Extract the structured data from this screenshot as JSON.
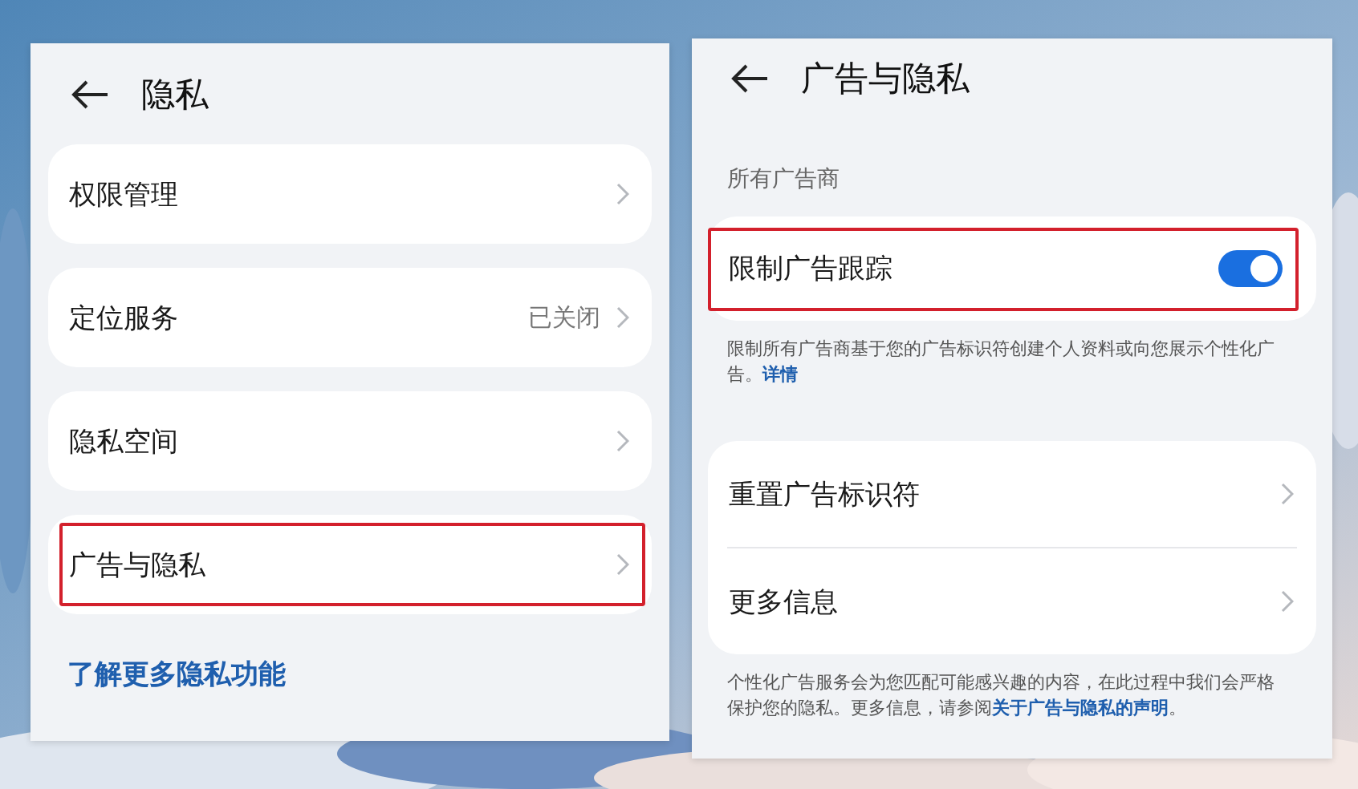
{
  "left_screen": {
    "title": "隐私",
    "items": [
      {
        "label": "权限管理",
        "highlighted": false
      },
      {
        "label": "定位服务",
        "value": "已关闭",
        "highlighted": false
      },
      {
        "label": "隐私空间",
        "highlighted": false
      },
      {
        "label": "广告与隐私",
        "highlighted": true
      }
    ],
    "link": "了解更多隐私功能"
  },
  "right_screen": {
    "title": "广告与隐私",
    "section_label": "所有广告商",
    "toggle_item": {
      "label": "限制广告跟踪",
      "on": true,
      "highlighted": true
    },
    "toggle_note": {
      "text": "限制所有广告商基于您的广告标识符创建个人资料或向您展示个性化广告。",
      "link": "详情"
    },
    "items": [
      {
        "label": "重置广告标识符"
      },
      {
        "label": "更多信息"
      }
    ],
    "footer_note": {
      "text": "个性化广告服务会为您匹配可能感兴趣的内容，在此过程中我们会严格保护您的隐私。更多信息，请参阅",
      "link": "关于广告与隐私的声明",
      "after": "。"
    }
  }
}
